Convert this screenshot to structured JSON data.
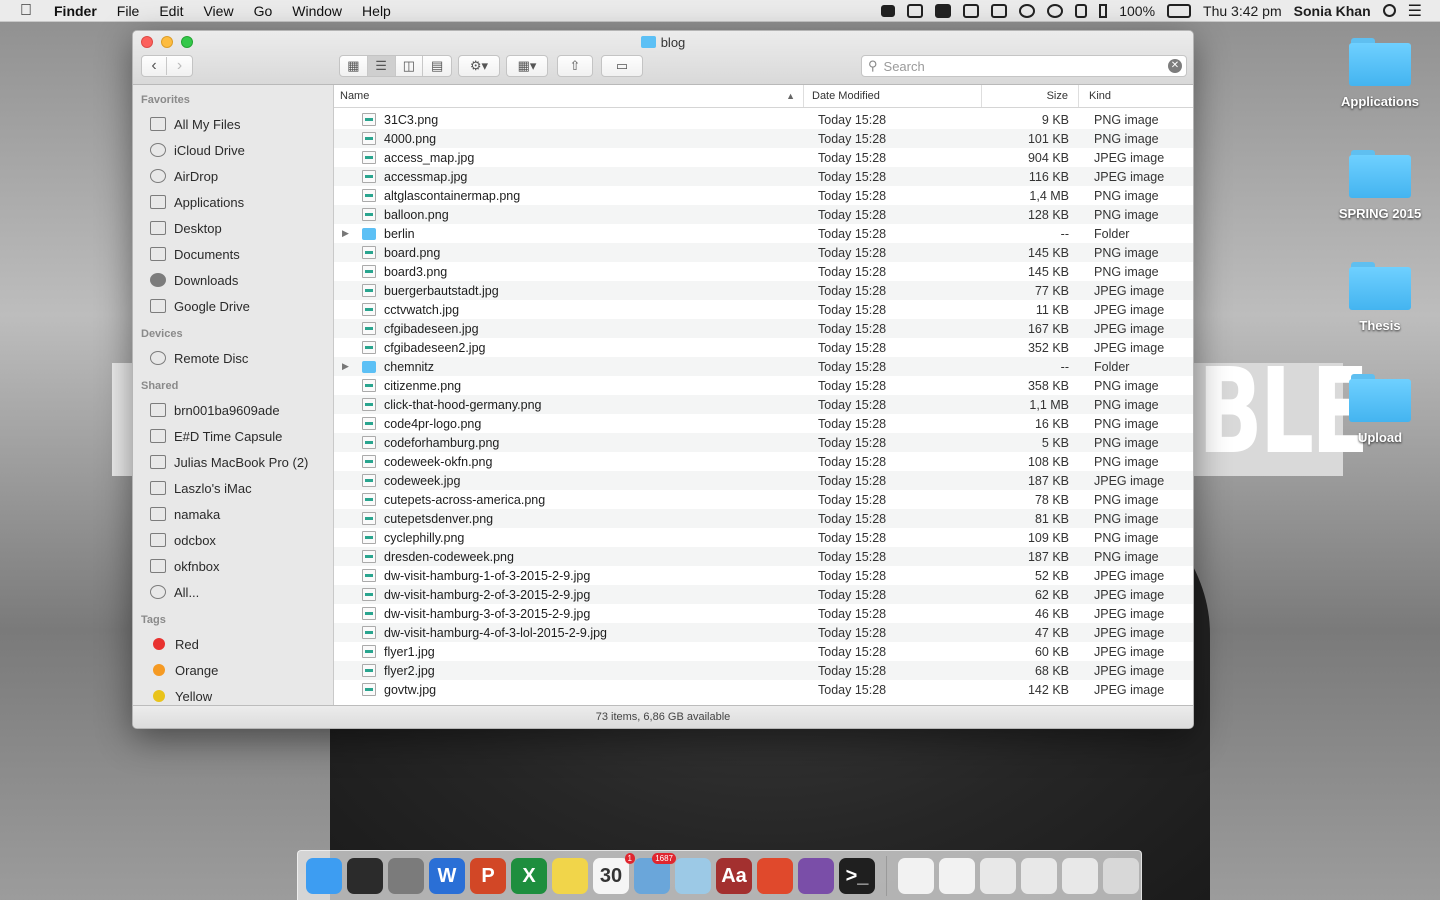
{
  "menubar": {
    "app": "Finder",
    "menus": [
      "File",
      "Edit",
      "View",
      "Go",
      "Window",
      "Help"
    ],
    "battery": "100%",
    "clock": "Thu 3:42 pm",
    "user": "Sonia Khan"
  },
  "wallpaper": {
    "text": "BLE"
  },
  "desktop_icons": [
    "Applications",
    "SPRING 2015",
    "Thesis",
    "Upload"
  ],
  "window": {
    "title": "blog",
    "search_placeholder": "Search",
    "status": "73 items, 6,86 GB available"
  },
  "sidebar": {
    "favorites_label": "Favorites",
    "favorites": [
      "All My Files",
      "iCloud Drive",
      "AirDrop",
      "Applications",
      "Desktop",
      "Documents",
      "Downloads",
      "Google Drive"
    ],
    "devices_label": "Devices",
    "devices": [
      "Remote Disc"
    ],
    "shared_label": "Shared",
    "shared": [
      "brn001ba9609ade",
      "E#D Time Capsule",
      "Julias MacBook Pro (2)",
      "Laszlo's iMac",
      "namaka",
      "odcbox",
      "okfnbox",
      "All..."
    ],
    "tags_label": "Tags",
    "tags": [
      {
        "name": "Red",
        "color": "#e8322f"
      },
      {
        "name": "Orange",
        "color": "#f59a23"
      },
      {
        "name": "Yellow",
        "color": "#e9c31a"
      }
    ]
  },
  "columns": {
    "name": "Name",
    "date": "Date Modified",
    "size": "Size",
    "kind": "Kind"
  },
  "files": [
    {
      "name": "31C3.png",
      "date": "Today 15:28",
      "size": "9 KB",
      "kind": "PNG image",
      "folder": false
    },
    {
      "name": "4000.png",
      "date": "Today 15:28",
      "size": "101 KB",
      "kind": "PNG image",
      "folder": false
    },
    {
      "name": "access_map.jpg",
      "date": "Today 15:28",
      "size": "904 KB",
      "kind": "JPEG image",
      "folder": false
    },
    {
      "name": "accessmap.jpg",
      "date": "Today 15:28",
      "size": "116 KB",
      "kind": "JPEG image",
      "folder": false
    },
    {
      "name": "altglascontainermap.png",
      "date": "Today 15:28",
      "size": "1,4 MB",
      "kind": "PNG image",
      "folder": false
    },
    {
      "name": "balloon.png",
      "date": "Today 15:28",
      "size": "128 KB",
      "kind": "PNG image",
      "folder": false
    },
    {
      "name": "berlin",
      "date": "Today 15:28",
      "size": "--",
      "kind": "Folder",
      "folder": true
    },
    {
      "name": "board.png",
      "date": "Today 15:28",
      "size": "145 KB",
      "kind": "PNG image",
      "folder": false
    },
    {
      "name": "board3.png",
      "date": "Today 15:28",
      "size": "145 KB",
      "kind": "PNG image",
      "folder": false
    },
    {
      "name": "buergerbautstadt.jpg",
      "date": "Today 15:28",
      "size": "77 KB",
      "kind": "JPEG image",
      "folder": false
    },
    {
      "name": "cctvwatch.jpg",
      "date": "Today 15:28",
      "size": "11 KB",
      "kind": "JPEG image",
      "folder": false
    },
    {
      "name": "cfgibadeseen.jpg",
      "date": "Today 15:28",
      "size": "167 KB",
      "kind": "JPEG image",
      "folder": false
    },
    {
      "name": "cfgibadeseen2.jpg",
      "date": "Today 15:28",
      "size": "352 KB",
      "kind": "JPEG image",
      "folder": false
    },
    {
      "name": "chemnitz",
      "date": "Today 15:28",
      "size": "--",
      "kind": "Folder",
      "folder": true
    },
    {
      "name": "citizenme.png",
      "date": "Today 15:28",
      "size": "358 KB",
      "kind": "PNG image",
      "folder": false
    },
    {
      "name": "click-that-hood-germany.png",
      "date": "Today 15:28",
      "size": "1,1 MB",
      "kind": "PNG image",
      "folder": false
    },
    {
      "name": "code4pr-logo.png",
      "date": "Today 15:28",
      "size": "16 KB",
      "kind": "PNG image",
      "folder": false
    },
    {
      "name": "codeforhamburg.png",
      "date": "Today 15:28",
      "size": "5 KB",
      "kind": "PNG image",
      "folder": false
    },
    {
      "name": "codeweek-okfn.png",
      "date": "Today 15:28",
      "size": "108 KB",
      "kind": "PNG image",
      "folder": false
    },
    {
      "name": "codeweek.jpg",
      "date": "Today 15:28",
      "size": "187 KB",
      "kind": "JPEG image",
      "folder": false
    },
    {
      "name": "cutepets-across-america.png",
      "date": "Today 15:28",
      "size": "78 KB",
      "kind": "PNG image",
      "folder": false
    },
    {
      "name": "cutepetsdenver.png",
      "date": "Today 15:28",
      "size": "81 KB",
      "kind": "PNG image",
      "folder": false
    },
    {
      "name": "cyclephilly.png",
      "date": "Today 15:28",
      "size": "109 KB",
      "kind": "PNG image",
      "folder": false
    },
    {
      "name": "dresden-codeweek.png",
      "date": "Today 15:28",
      "size": "187 KB",
      "kind": "PNG image",
      "folder": false
    },
    {
      "name": "dw-visit-hamburg-1-of-3-2015-2-9.jpg",
      "date": "Today 15:28",
      "size": "52 KB",
      "kind": "JPEG image",
      "folder": false
    },
    {
      "name": "dw-visit-hamburg-2-of-3-2015-2-9.jpg",
      "date": "Today 15:28",
      "size": "62 KB",
      "kind": "JPEG image",
      "folder": false
    },
    {
      "name": "dw-visit-hamburg-3-of-3-2015-2-9.jpg",
      "date": "Today 15:28",
      "size": "46 KB",
      "kind": "JPEG image",
      "folder": false
    },
    {
      "name": "dw-visit-hamburg-4-of-3-lol-2015-2-9.jpg",
      "date": "Today 15:28",
      "size": "47 KB",
      "kind": "JPEG image",
      "folder": false
    },
    {
      "name": "flyer1.jpg",
      "date": "Today 15:28",
      "size": "60 KB",
      "kind": "JPEG image",
      "folder": false
    },
    {
      "name": "flyer2.jpg",
      "date": "Today 15:28",
      "size": "68 KB",
      "kind": "JPEG image",
      "folder": false
    },
    {
      "name": "govtw.jpg",
      "date": "Today 15:28",
      "size": "142 KB",
      "kind": "JPEG image",
      "folder": false
    }
  ],
  "dock": [
    {
      "name": "finder",
      "label": "",
      "color": "#3d9df2"
    },
    {
      "name": "mission-control",
      "label": "",
      "color": "#2b2b2b"
    },
    {
      "name": "system-preferences",
      "label": "",
      "color": "#7b7b7b"
    },
    {
      "name": "word",
      "label": "W",
      "color": "#2a6fd6"
    },
    {
      "name": "powerpoint",
      "label": "P",
      "color": "#d24726"
    },
    {
      "name": "excel",
      "label": "X",
      "color": "#1e8e3e"
    },
    {
      "name": "stickies",
      "label": "",
      "color": "#f1d54a"
    },
    {
      "name": "calendar",
      "label": "30",
      "color": "#f5f5f5",
      "badge": "1"
    },
    {
      "name": "mail",
      "label": "",
      "color": "#6aa6da",
      "badge": "1687"
    },
    {
      "name": "preview",
      "label": "",
      "color": "#9cc9e6"
    },
    {
      "name": "dictionary",
      "label": "Aa",
      "color": "#a3302f"
    },
    {
      "name": "chrome",
      "label": "",
      "color": "#e0492c"
    },
    {
      "name": "github",
      "label": "",
      "color": "#7a4ea8"
    },
    {
      "name": "terminal",
      "label": ">_",
      "color": "#1f1f1f"
    },
    {
      "name": "document-1",
      "label": "",
      "color": "#f2f2f2"
    },
    {
      "name": "document-2",
      "label": "",
      "color": "#f2f2f2"
    },
    {
      "name": "screenshot-1",
      "label": "",
      "color": "#e8e8e8"
    },
    {
      "name": "screenshot-2",
      "label": "",
      "color": "#e8e8e8"
    },
    {
      "name": "screenshot-3",
      "label": "",
      "color": "#e8e8e8"
    },
    {
      "name": "trash",
      "label": "",
      "color": "#d8d8d8"
    }
  ]
}
